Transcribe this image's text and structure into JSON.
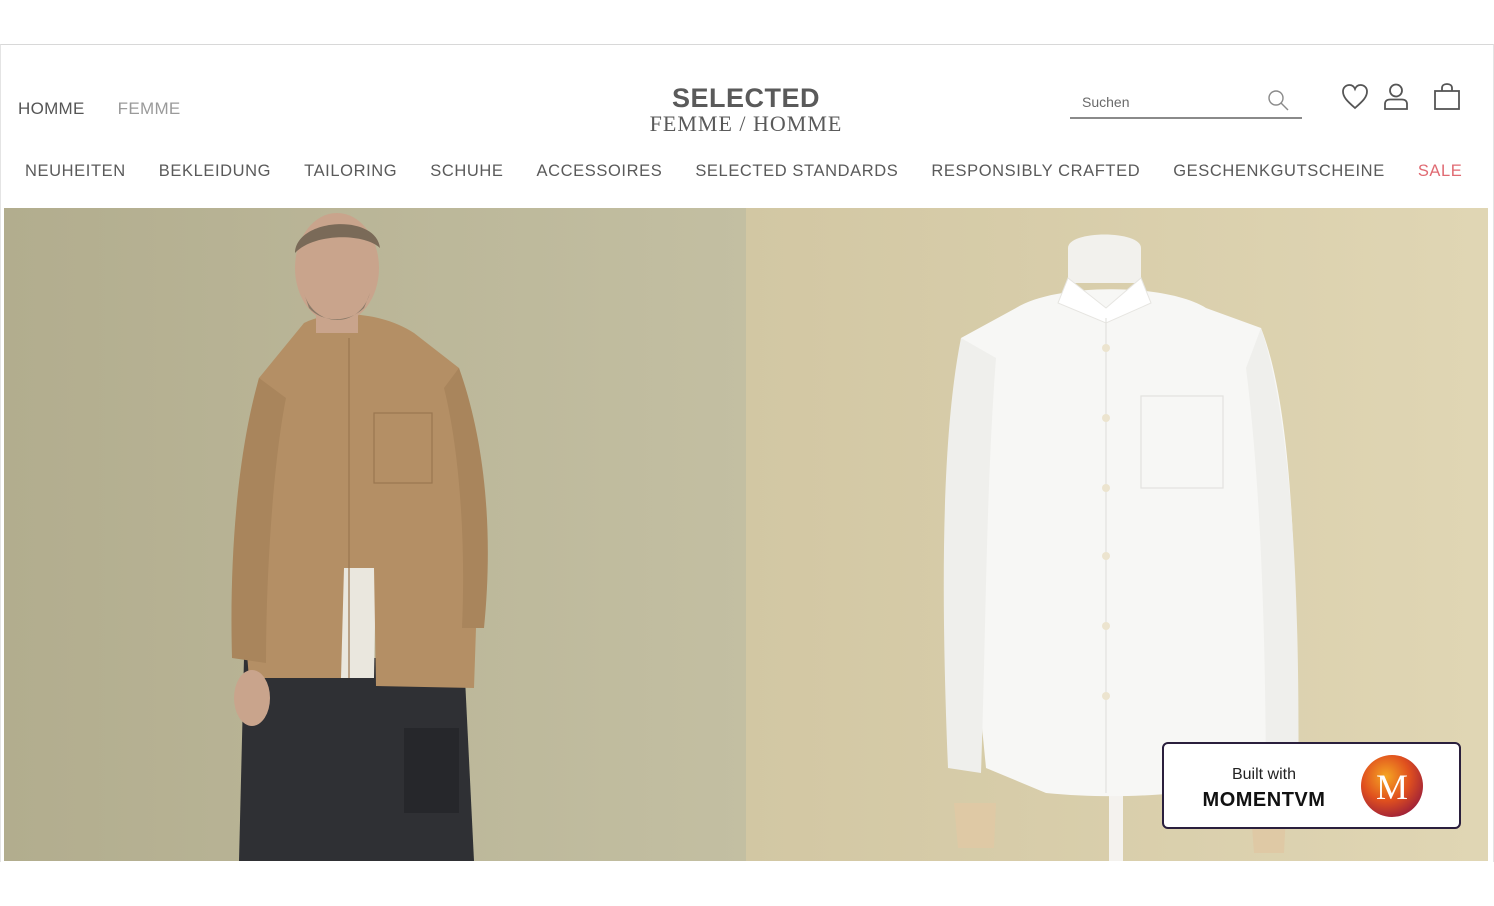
{
  "header": {
    "gender_tabs": [
      {
        "label": "HOMME",
        "active": true
      },
      {
        "label": "FEMME",
        "active": false
      }
    ],
    "logo": {
      "line1": "SELECTED",
      "line2": "FEMME / HOMME"
    },
    "search": {
      "placeholder": "Suchen",
      "icon": "search-icon"
    },
    "icons": [
      "heart-icon",
      "user-icon",
      "shopping-bag-icon"
    ]
  },
  "main_nav": [
    {
      "label": "NEUHEITEN"
    },
    {
      "label": "BEKLEIDUNG"
    },
    {
      "label": "TAILORING"
    },
    {
      "label": "SCHUHE"
    },
    {
      "label": "ACCESSOIRES"
    },
    {
      "label": "SELECTED STANDARDS"
    },
    {
      "label": "RESPONSIBLY CRAFTED"
    },
    {
      "label": "GESCHENKGUTSCHEINE"
    },
    {
      "label": "SALE",
      "color": "#e06a72"
    }
  ],
  "badge": {
    "built": "Built with",
    "brand": "MOMENTVM",
    "logo_letter": "M"
  },
  "colors": {
    "text": "#555555",
    "sale": "#e06a72",
    "hero_left_bg": "#bdb99a",
    "hero_right_bg": "#d6ccab"
  }
}
